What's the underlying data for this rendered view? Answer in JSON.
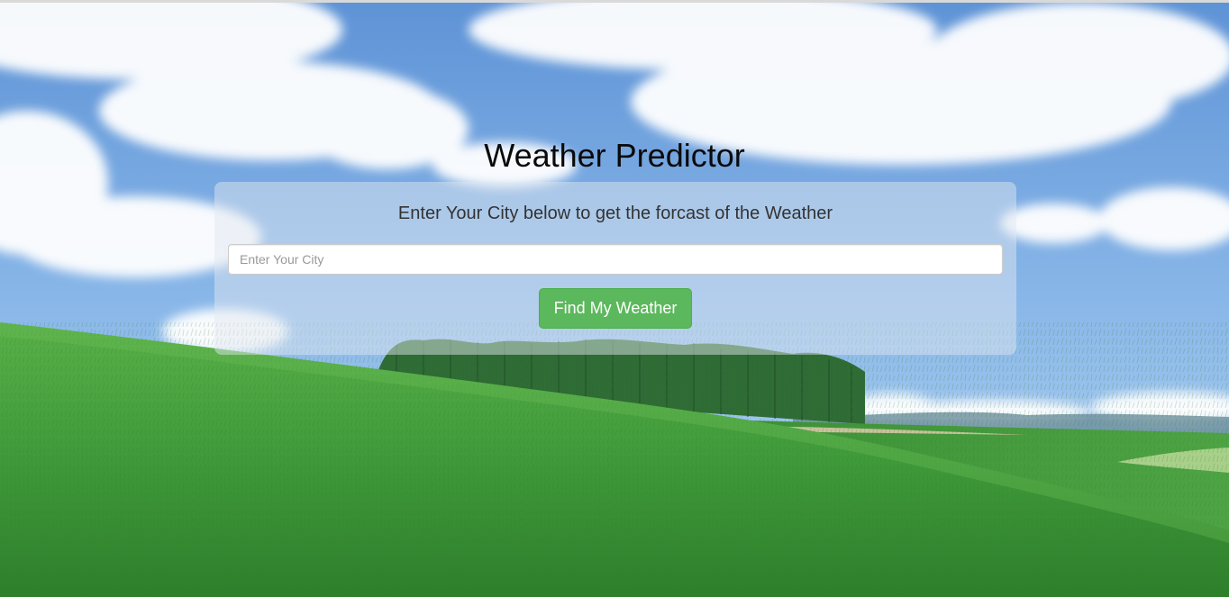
{
  "page": {
    "title": "Weather Predictor",
    "subtitle": "Enter Your City below to get the forcast of the Weather"
  },
  "search": {
    "placeholder": "Enter Your City",
    "value": ""
  },
  "actions": {
    "find_label": "Find My Weather"
  },
  "background": {
    "description_icon": "landscape-photo",
    "sky_color": "#6fa3dd",
    "grass_color": "#3f9a3a"
  },
  "colors": {
    "button": "#5cb85c",
    "button_border": "#4cae4c",
    "title_text": "#0a0a0a",
    "subtitle_text": "#333333"
  }
}
